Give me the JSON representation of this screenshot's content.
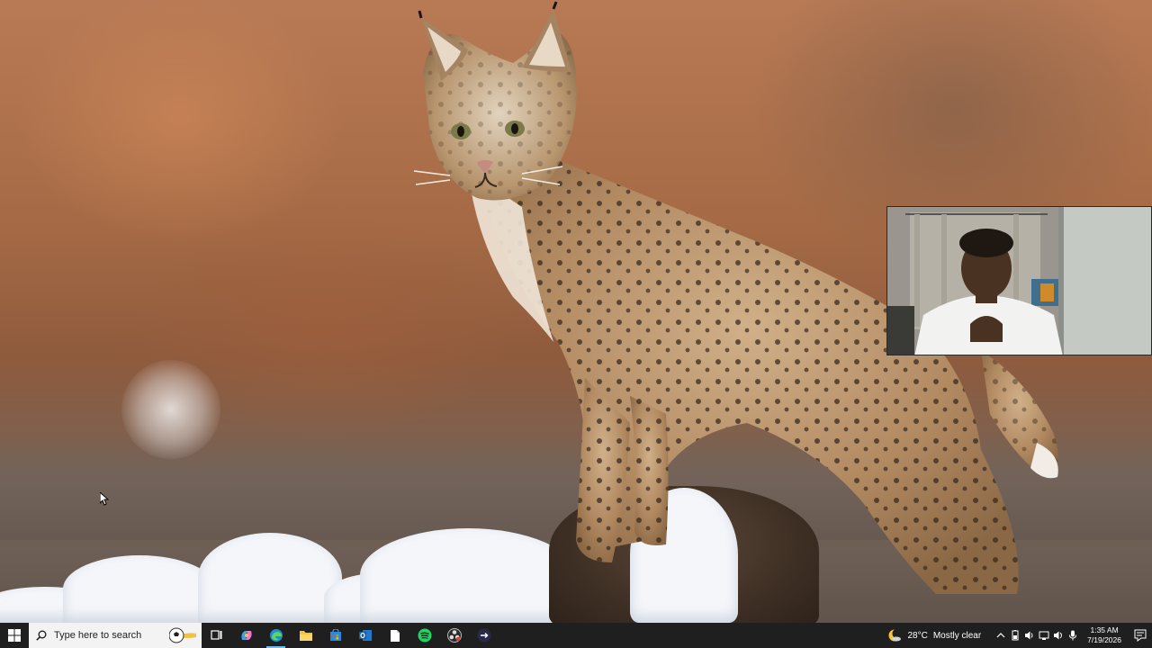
{
  "desktop": {
    "wallpaper_icon": "bobcat-on-snowy-log-wallpaper",
    "cursor_icon": "mouse-pointer-icon"
  },
  "webcam": {
    "icon": "webcam-overlay-person"
  },
  "taskbar": {
    "search_placeholder": "Type here to search",
    "apps": [
      {
        "name": "task-view",
        "icon": "task-view-icon"
      },
      {
        "name": "copilot",
        "icon": "copilot-icon"
      },
      {
        "name": "edge",
        "icon": "edge-icon",
        "active": true
      },
      {
        "name": "file-explorer",
        "icon": "folder-icon"
      },
      {
        "name": "store",
        "icon": "store-icon"
      },
      {
        "name": "outlook",
        "icon": "outlook-icon"
      },
      {
        "name": "notepad",
        "icon": "file-icon"
      },
      {
        "name": "spotify",
        "icon": "spotify-icon"
      },
      {
        "name": "obs",
        "icon": "obs-icon"
      },
      {
        "name": "davinci",
        "icon": "app-icon"
      }
    ],
    "weather": {
      "temp": "28°C",
      "condition": "Mostly clear"
    },
    "clock": {
      "time": "1:35 AM",
      "date": "7/19/2026"
    },
    "colors": {
      "taskbar_bg": "#1f1f1f",
      "search_bg": "#f3f3f3",
      "active_indicator": "#76b9ed"
    }
  }
}
